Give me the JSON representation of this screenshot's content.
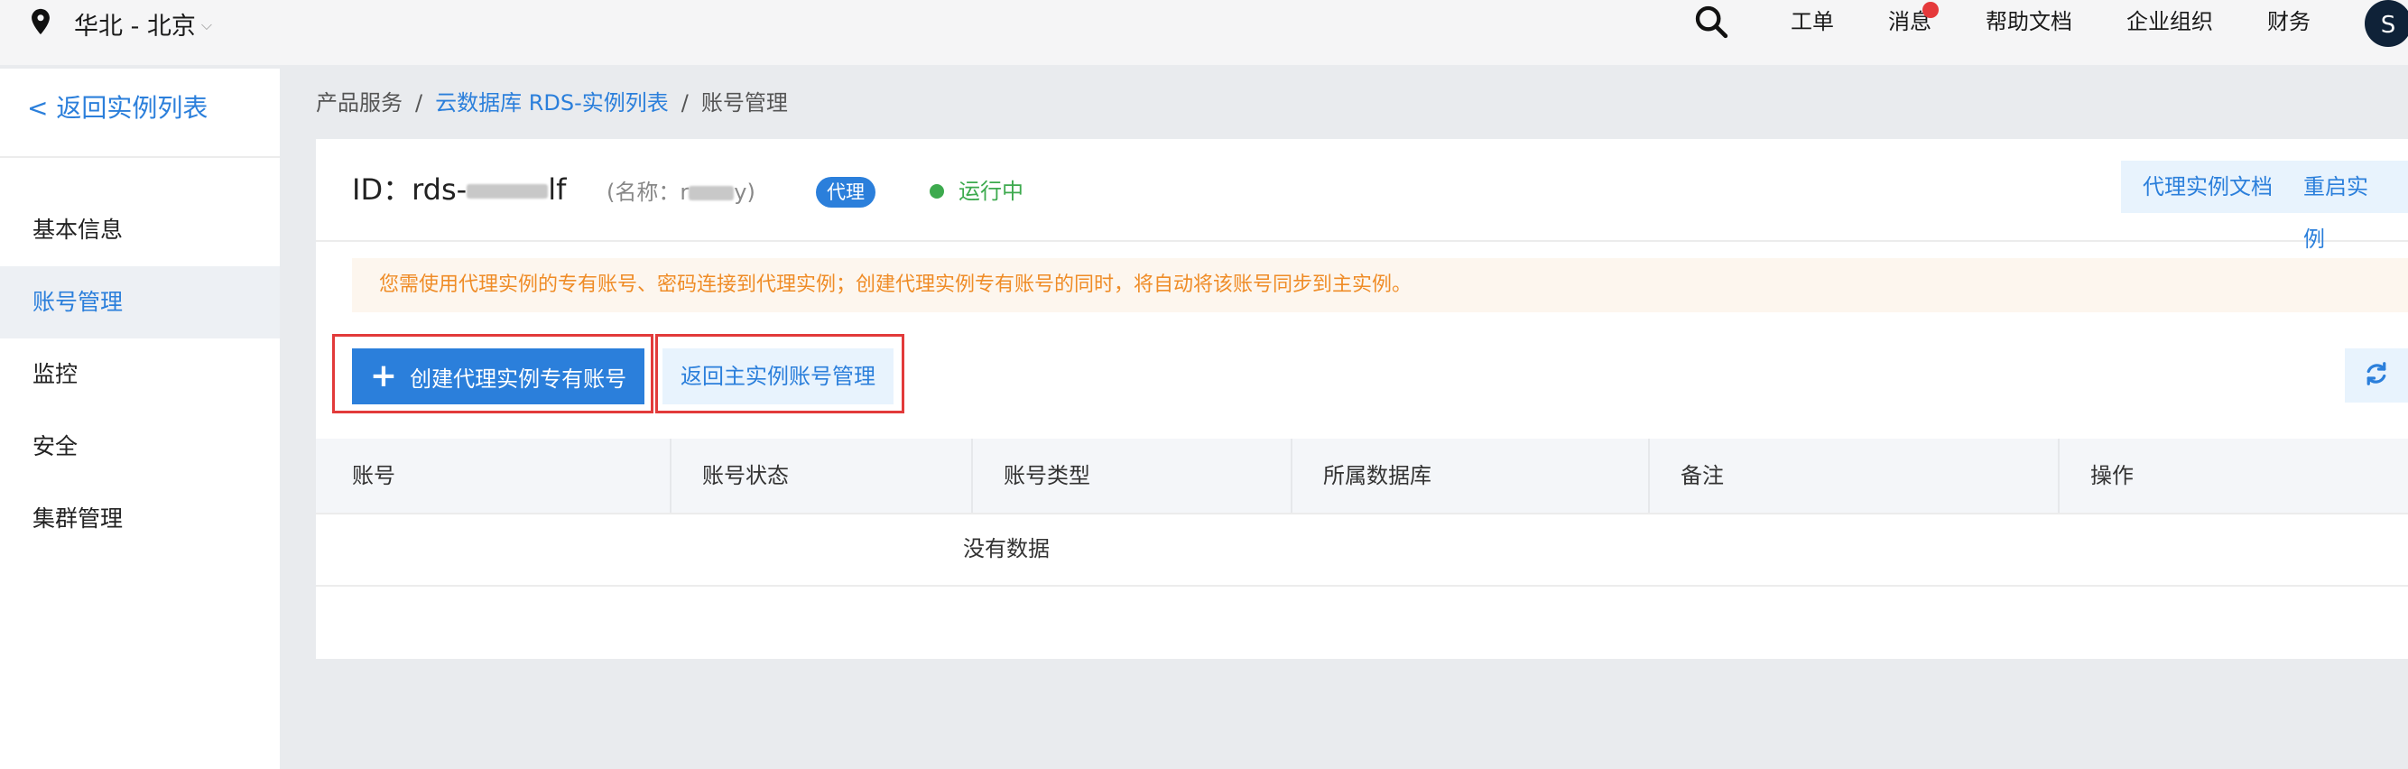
{
  "topbar": {
    "region": "华北 - 北京",
    "nav": [
      "工单",
      "消息",
      "帮助文档",
      "企业组织",
      "财务"
    ],
    "avatar": "S"
  },
  "sidebar": {
    "back": "< 返回实例列表",
    "items": [
      "基本信息",
      "账号管理",
      "监控",
      "安全",
      "集群管理"
    ],
    "active": "账号管理"
  },
  "breadcrumb": {
    "root": "产品服务",
    "link": "云数据库 RDS-实例列表",
    "current": "账号管理",
    "sep": "/"
  },
  "instance": {
    "id_prefix": "ID：rds-",
    "id_suffix": "lf",
    "name_prefix": "(名称：r",
    "name_suffix": "y)",
    "tag": "代理",
    "status": "运行中",
    "buttons": [
      "代理实例文档",
      "重启实例"
    ]
  },
  "notice": "您需使用代理实例的专有账号、密码连接到代理实例；创建代理实例专有账号的同时，将自动将该账号同步到主实例。",
  "actions": {
    "create": "创建代理实例专有账号",
    "back_main": "返回主实例账号管理"
  },
  "table": {
    "columns": [
      "账号",
      "账号状态",
      "账号类型",
      "所属数据库",
      "备注",
      "操作"
    ],
    "empty": "没有数据"
  },
  "colors": {
    "accent": "#2b7fdb",
    "status_green": "#3daa4e",
    "notice_orange": "#ef8c27",
    "highlight_red": "#e23a3a"
  }
}
